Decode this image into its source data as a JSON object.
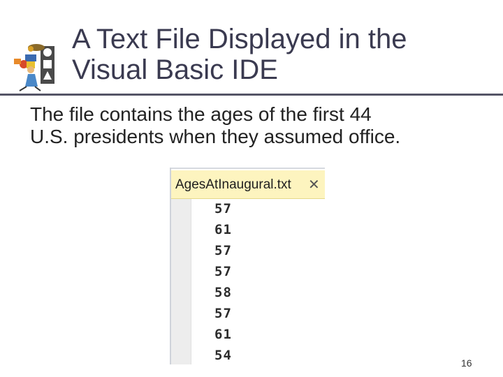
{
  "slide": {
    "title_line1": "A Text File Displayed in the",
    "title_line2": "Visual Basic IDE",
    "body_line1": "The file contains the ages of the first 44",
    "body_line2": "U.S. presidents when they assumed office.",
    "page_number": "16"
  },
  "editor": {
    "tab_title": "AgesAtInaugural.txt",
    "close_glyph": "✕",
    "lines": [
      "57",
      "61",
      "57",
      "57",
      "58",
      "57",
      "61",
      "54"
    ]
  },
  "colors": {
    "title": "#3a3a50",
    "tab_background": "#fdf4bf",
    "gutter": "#ededed"
  },
  "icons": {
    "logo": "presenter-with-shapes-icon",
    "close": "close-icon"
  }
}
